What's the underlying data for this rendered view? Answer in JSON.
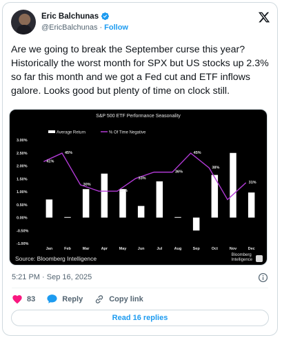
{
  "author": {
    "name": "Eric Balchunas",
    "handle": "@EricBalchunas",
    "separator": "·",
    "follow_label": "Follow"
  },
  "tweet": {
    "text": "Are we going to break the September curse this year? Historically the worst month for SPX but US stocks up 2.3% so far this month and we got a Fed cut and ETF inflows galore. Looks good but plenty of time on clock still.",
    "timestamp": "5:21 PM · Sep 16, 2025"
  },
  "media": {
    "source": "Source: Bloomberg Intelligence",
    "brand_line1": "Bloomberg",
    "brand_line2": "Intelligence"
  },
  "chart_data": {
    "type": "bar",
    "title": "S&P 500 ETF Performance Seasonality",
    "categories": [
      "Jan",
      "Feb",
      "Mar",
      "Apr",
      "May",
      "Jun",
      "Jul",
      "Aug",
      "Sep",
      "Oct",
      "Nov",
      "Dec"
    ],
    "series": [
      {
        "name": "Average Return",
        "type": "bar",
        "axis": "left",
        "values": [
          0.7,
          0.02,
          1.1,
          1.7,
          1.1,
          0.45,
          1.4,
          0.02,
          -0.5,
          1.65,
          2.5,
          0.97
        ]
      },
      {
        "name": "% Of Time Negative",
        "type": "line",
        "axis": "right",
        "values": [
          41,
          45,
          30,
          27,
          27,
          33,
          36,
          36,
          45,
          38,
          23,
          31
        ]
      }
    ],
    "point_labels": [
      "41%",
      "45%",
      "30%",
      "",
      "27%",
      "33%",
      "",
      "36%",
      "45%",
      "38%",
      "",
      "31%"
    ],
    "y_ticks": [
      "3.00%",
      "2.50%",
      "2.00%",
      "1.50%",
      "1.00%",
      "0.50%",
      "0.00%",
      "-0.50%",
      "-1.00%"
    ],
    "ylim": [
      -1.0,
      3.0
    ],
    "colors": {
      "bars": "#ffffff",
      "line": "#b23ad6",
      "background": "#000000"
    },
    "legend_position": "top-left",
    "grid": false
  },
  "engagement": {
    "likes": "83",
    "reply_label": "Reply",
    "copy_link_label": "Copy link"
  },
  "read_replies_label": "Read 16 replies",
  "icons": {
    "verified": "verified-badge-icon",
    "x_logo": "x-logo-icon",
    "info": "info-icon",
    "heart": "heart-icon",
    "reply": "reply-bubble-icon",
    "link": "link-icon"
  }
}
